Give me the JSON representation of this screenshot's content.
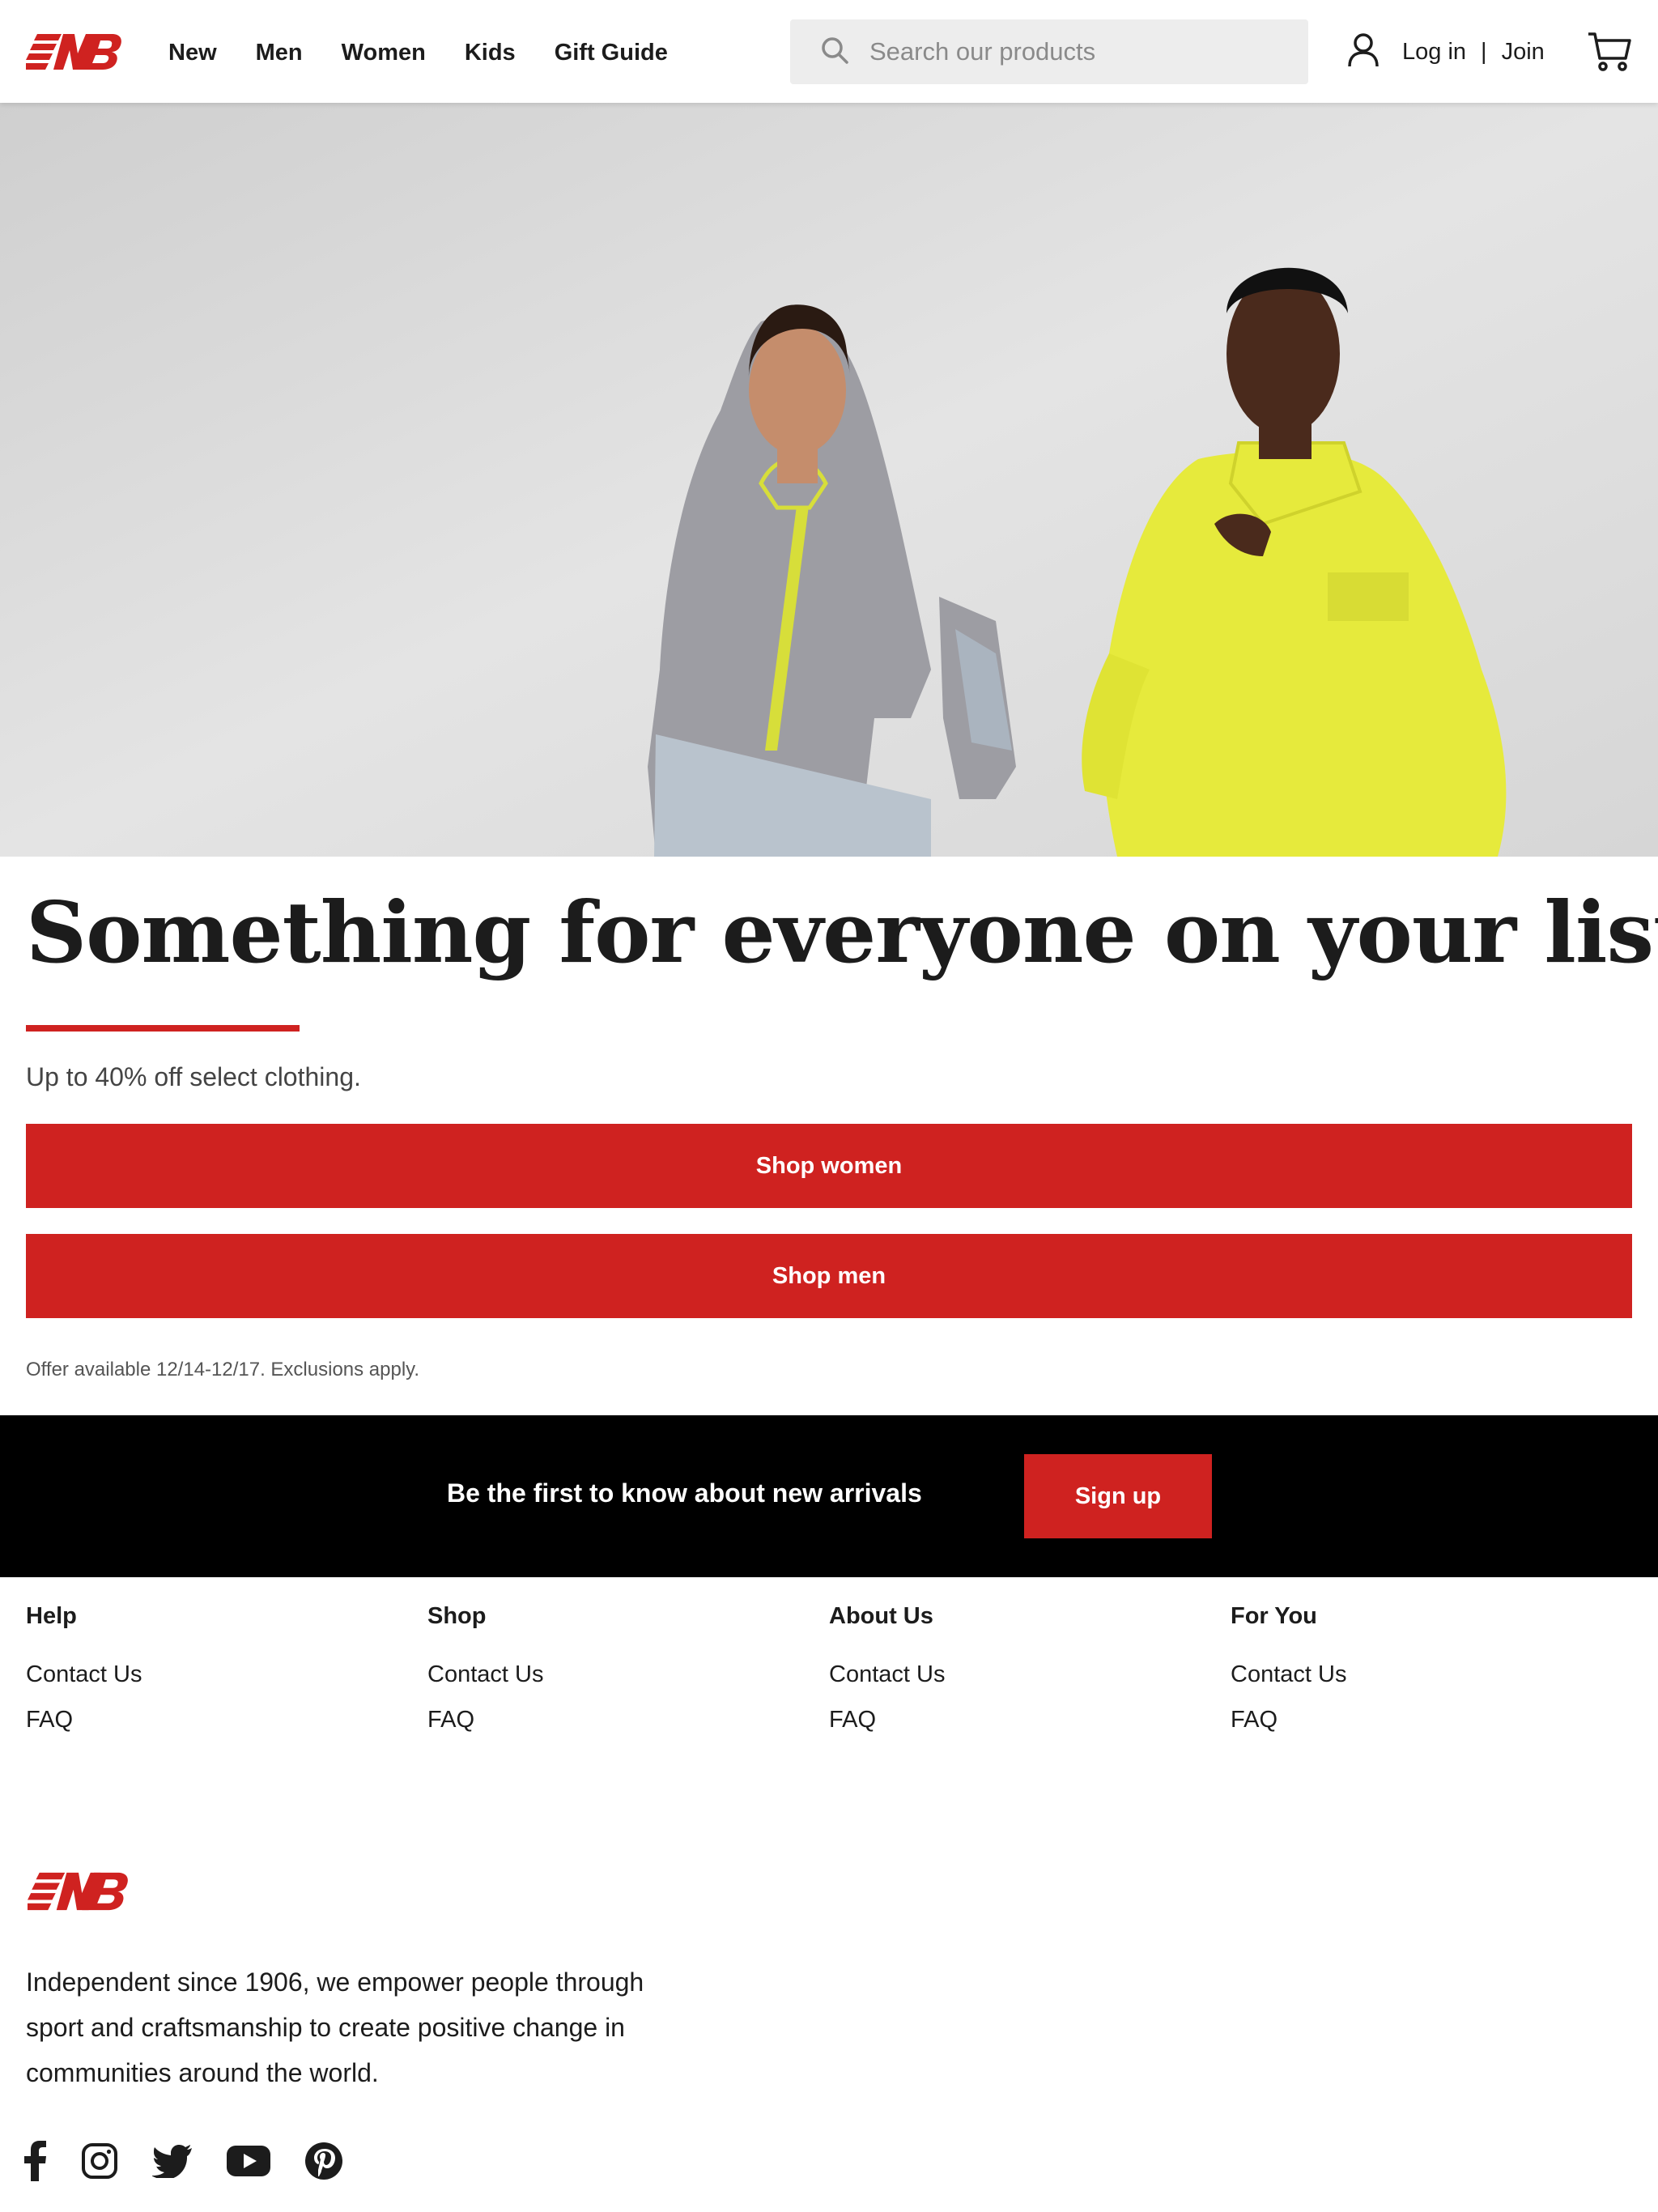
{
  "header": {
    "nav": [
      "New",
      "Men",
      "Women",
      "Kids",
      "Gift Guide"
    ],
    "search_placeholder": "Search our products",
    "login": "Log in",
    "separator": "|",
    "join": "Join"
  },
  "hero": {
    "headline": "Something for everyone on your list.",
    "subtext": "Up to 40% off select clothing.",
    "cta_women": "Shop women",
    "cta_men": "Shop men",
    "offer": "Offer available 12/14-12/17. Exclusions apply."
  },
  "signup": {
    "text": "Be the first to know about new arrivals",
    "button": "Sign up"
  },
  "footer": {
    "columns": [
      {
        "title": "Help",
        "links": [
          "Contact Us",
          "FAQ"
        ]
      },
      {
        "title": "Shop",
        "links": [
          "Contact Us",
          "FAQ"
        ]
      },
      {
        "title": "About Us",
        "links": [
          "Contact Us",
          "FAQ"
        ]
      },
      {
        "title": "For You",
        "links": [
          "Contact Us",
          "FAQ"
        ]
      }
    ],
    "about": "Independent since 1906, we empower people through sport and craftsmanship to create positive change in communities around the world.",
    "social": [
      "facebook-icon",
      "instagram-icon",
      "twitter-icon",
      "youtube-icon",
      "pinterest-icon"
    ]
  },
  "colors": {
    "brand_red": "#cf2220",
    "black_bar": "#000000"
  }
}
